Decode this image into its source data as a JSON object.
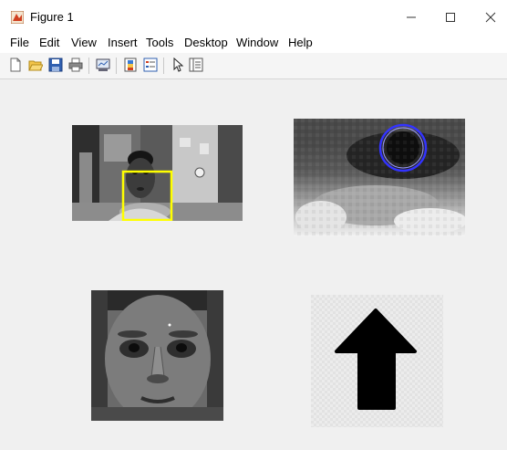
{
  "window": {
    "title": "Figure 1",
    "controls": {
      "minimize": "–",
      "maximize": "☐",
      "close": "✕"
    }
  },
  "menu": [
    "File",
    "Edit",
    "View",
    "Insert",
    "Tools",
    "Desktop",
    "Window",
    "Help"
  ],
  "toolbar": [
    "new-figure-icon",
    "open-file-icon",
    "save-icon",
    "print-icon",
    "link-plot-icon",
    "colorbar-icon",
    "legend-icon",
    "pointer-icon",
    "property-inspector-icon"
  ],
  "subplots": [
    {
      "content": "grayscale webcam frame with detected face",
      "box_color": "#ffff00"
    },
    {
      "content": "zoomed eye region with detected pupil",
      "circle_color": "#3333ff"
    },
    {
      "content": "cropped grayscale face"
    },
    {
      "content": "direction arrow",
      "direction": "up"
    }
  ],
  "colors": {
    "background": "#f0f0f0",
    "titlebar": "#ffffff",
    "accent_icon": "#d04020"
  }
}
